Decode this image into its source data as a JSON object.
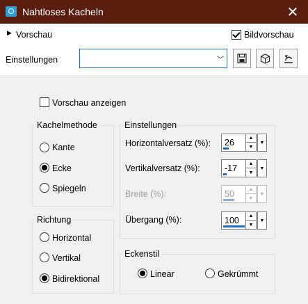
{
  "window": {
    "title": "Nahtloses Kacheln"
  },
  "preview_section": {
    "label": "Vorschau",
    "bild_label": "Bildvorschau",
    "bild_checked": true
  },
  "settings": {
    "label": "Einstellungen",
    "value": ""
  },
  "show_preview": {
    "label": "Vorschau anzeigen",
    "checked": false
  },
  "method": {
    "title": "Kachelmethode",
    "options": [
      {
        "label": "Kante",
        "checked": false
      },
      {
        "label": "Ecke",
        "checked": true
      },
      {
        "label": "Spiegeln",
        "checked": false
      }
    ]
  },
  "direction": {
    "title": "Richtung",
    "options": [
      {
        "label": "Horizontal",
        "checked": false
      },
      {
        "label": "Vertikal",
        "checked": false
      },
      {
        "label": "Bidirektional",
        "checked": true
      }
    ]
  },
  "params": {
    "title": "Einstellungen",
    "fields": [
      {
        "label": "Horizontalversatz (%):",
        "value": "26",
        "fill_percent": 26,
        "disabled": false
      },
      {
        "label": "Vertikalversatz (%):",
        "value": "-17",
        "fill_percent": 17,
        "disabled": false
      },
      {
        "label": "Breite (%):",
        "value": "50",
        "fill_percent": 50,
        "disabled": true
      },
      {
        "label": "Übergang (%):",
        "value": "100",
        "fill_percent": 100,
        "disabled": false
      }
    ]
  },
  "corner": {
    "title": "Eckenstil",
    "options": [
      {
        "label": "Linear",
        "checked": true
      },
      {
        "label": "Gekrümmt",
        "checked": false
      }
    ]
  },
  "icons": {
    "app": "camera-icon",
    "close": "close-icon",
    "save": "save-icon",
    "randomize": "dice-icon",
    "reset": "reset-icon"
  }
}
